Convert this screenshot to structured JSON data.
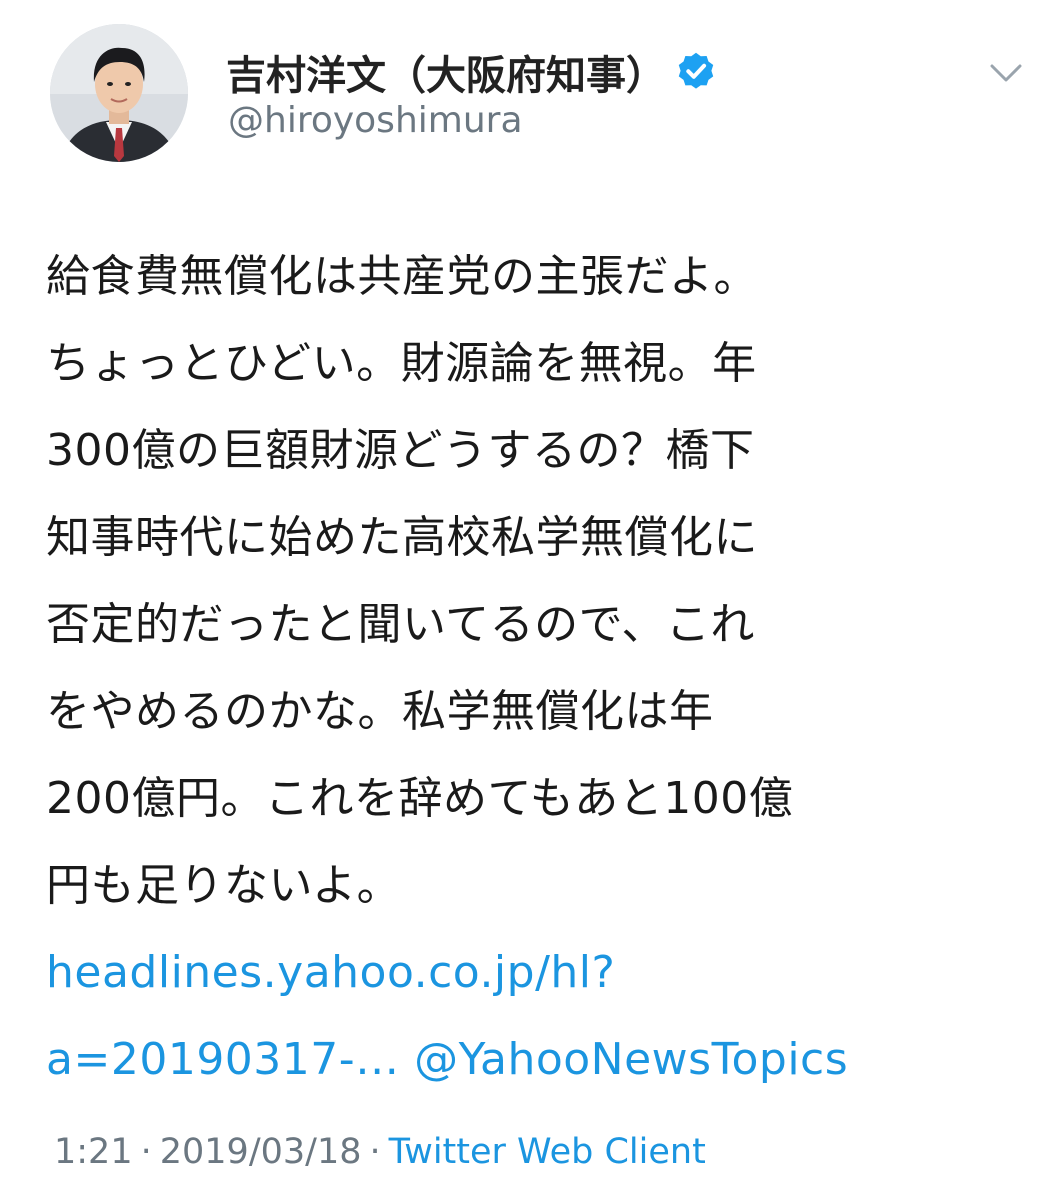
{
  "user": {
    "display_name": "吉村洋文（大阪府知事）",
    "handle": "@hiroyoshimura",
    "verified": true,
    "avatar_icon": "profile-photo"
  },
  "header": {
    "menu_icon": "chevron-down-icon"
  },
  "tweet": {
    "lines": [
      "給食費無償化は共産党の主張だよ。",
      "ちょっとひどい。財源論を無視。年",
      "300億の巨額財源どうするの？橋下",
      "知事時代に始めた高校私学無償化に",
      "否定的だったと聞いてるので、これ",
      "をやめるのかな。私学無償化は年",
      "200億円。これを辞めてもあと100億",
      "円も足りないよ。"
    ],
    "link_url_part1": "headlines.yahoo.co.jp/hl?",
    "link_url_part2": "a=20190317-…",
    "mention": "@YahooNewsTopics"
  },
  "meta": {
    "time": "1:21",
    "separator": "·",
    "date": "2019/03/18",
    "source": "Twitter Web Client"
  },
  "colors": {
    "link": "#1b95e0",
    "secondary_text": "#6b7781",
    "verified_badge": "#1da1f2"
  }
}
